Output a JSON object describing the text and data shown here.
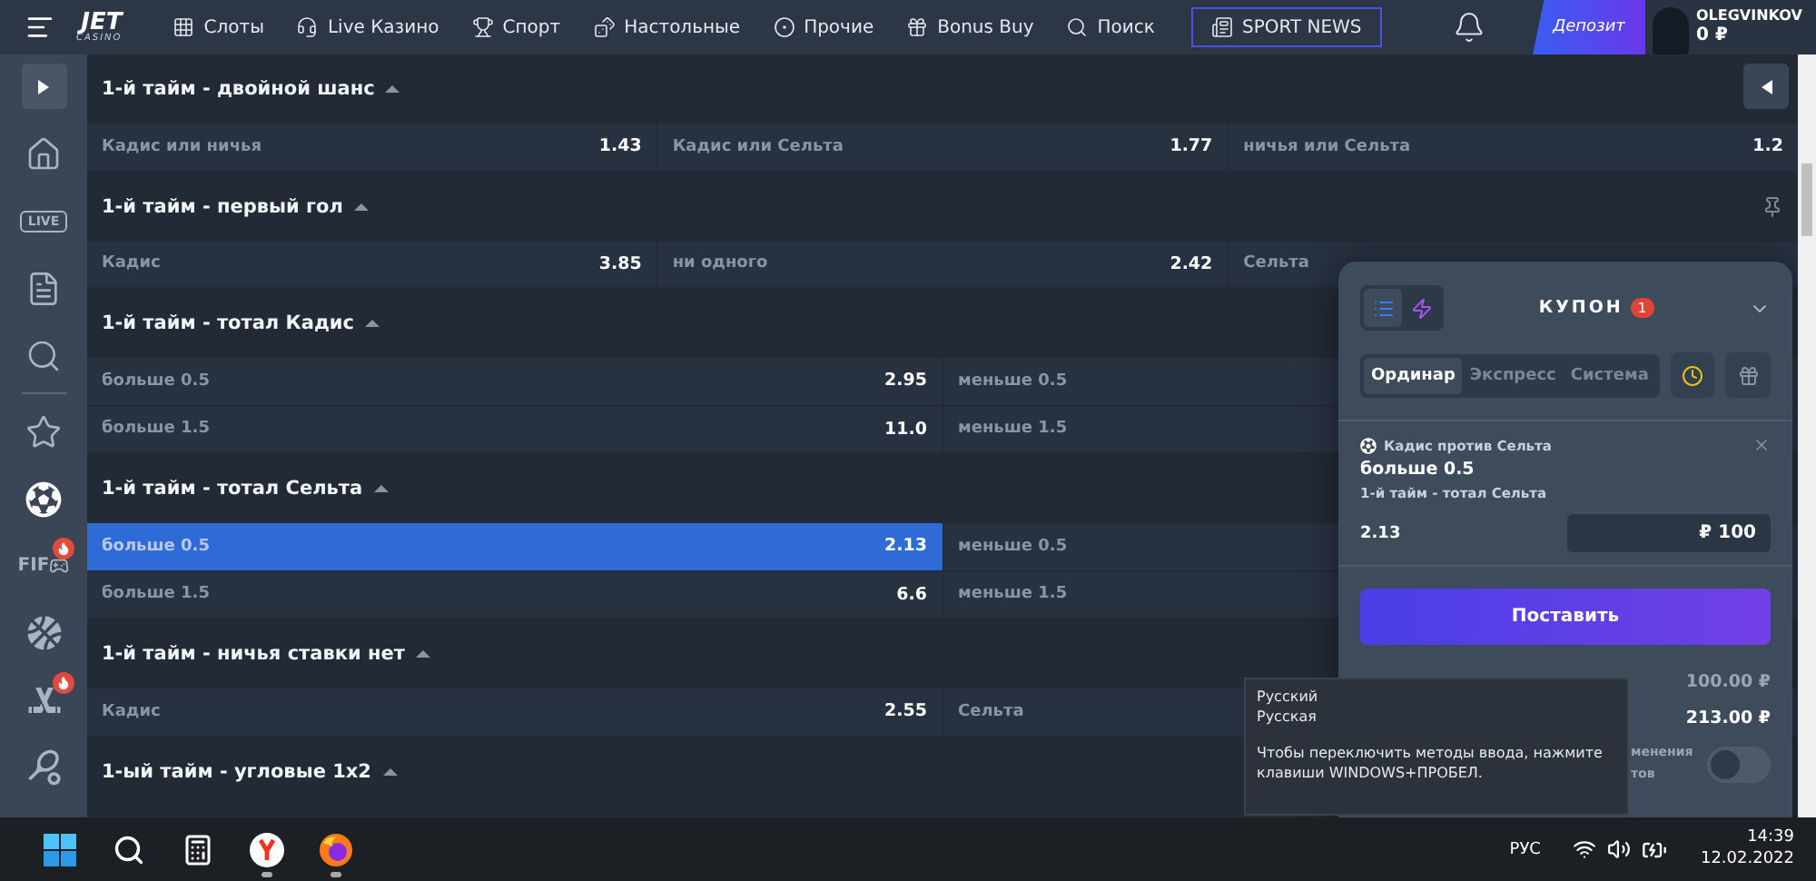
{
  "header": {
    "logo": {
      "name": "JET",
      "sub": "CASINO"
    },
    "nav": [
      {
        "kind": "slots",
        "label": "Слоты",
        "selected": false
      },
      {
        "kind": "live",
        "label": "Live Казино",
        "selected": false
      },
      {
        "kind": "sport",
        "label": "Спорт",
        "selected": false
      },
      {
        "kind": "table",
        "label": "Настольные",
        "selected": false
      },
      {
        "kind": "other",
        "label": "Прочие",
        "selected": false
      },
      {
        "kind": "bonus",
        "label": "Bonus Buy",
        "selected": false
      },
      {
        "kind": "search",
        "label": "Поиск",
        "selected": false
      },
      {
        "kind": "news",
        "label": "SPORT NEWS",
        "selected": true
      }
    ],
    "deposit": "Депозит",
    "user": {
      "name": "OLEGVINKOV",
      "balance": "0 ₽"
    }
  },
  "sidebar": {
    "items": [
      {
        "kind": "home",
        "selected": false,
        "hot": false
      },
      {
        "kind": "live",
        "label": "LIVE",
        "selected": false,
        "hot": false
      },
      {
        "kind": "docs",
        "selected": false,
        "hot": false
      },
      {
        "kind": "search",
        "selected": false,
        "hot": false
      },
      {
        "kind": "star",
        "selected": false,
        "hot": false
      },
      {
        "kind": "soccer",
        "selected": true,
        "hot": false
      },
      {
        "kind": "fifa",
        "label": "FIF",
        "selected": false,
        "hot": true
      },
      {
        "kind": "basketball",
        "selected": false,
        "hot": false
      },
      {
        "kind": "hockey",
        "selected": false,
        "hot": true
      },
      {
        "kind": "tennis",
        "selected": false,
        "hot": false
      }
    ]
  },
  "markets": [
    {
      "title": "1-й тайм - двойной шанс",
      "rows": [
        {
          "cells": [
            {
              "label": "Кадис или ничья",
              "odds": "1.43",
              "selected": false
            },
            {
              "label": "Кадис или Сельта",
              "odds": "1.77",
              "selected": false
            },
            {
              "label": "ничья или Сельта",
              "odds": "1.2",
              "selected": false
            }
          ]
        }
      ]
    },
    {
      "title": "1-й тайм - первый гол",
      "rows": [
        {
          "cells": [
            {
              "label": "Кадис",
              "odds": "3.85",
              "selected": false
            },
            {
              "label": "ни одного",
              "odds": "2.42",
              "selected": false
            },
            {
              "label": "Сельта",
              "selected": false
            }
          ]
        }
      ]
    },
    {
      "title": "1-й тайм - тотал Кадис",
      "rows": [
        {
          "cells": [
            {
              "label": "больше 0.5",
              "odds": "2.95",
              "selected": false
            },
            {
              "label": "меньше 0.5",
              "selected": false
            }
          ]
        },
        {
          "cells": [
            {
              "label": "больше 1.5",
              "odds": "11.0",
              "selected": false
            },
            {
              "label": "меньше 1.5",
              "selected": false
            }
          ]
        }
      ]
    },
    {
      "title": "1-й тайм - тотал Сельта",
      "rows": [
        {
          "cells": [
            {
              "label": "больше 0.5",
              "odds": "2.13",
              "selected": true
            },
            {
              "label": "меньше 0.5",
              "selected": false
            }
          ]
        },
        {
          "cells": [
            {
              "label": "больше 1.5",
              "odds": "6.6",
              "selected": false
            },
            {
              "label": "меньше 1.5",
              "selected": false
            }
          ]
        }
      ]
    },
    {
      "title": "1-й тайм - ничья ставки нет",
      "rows": [
        {
          "cells": [
            {
              "label": "Кадис",
              "odds": "2.55",
              "selected": false
            },
            {
              "label": "Сельта",
              "selected": false
            }
          ]
        }
      ]
    },
    {
      "title": "1-ый тайм - угловые 1x2"
    }
  ],
  "coupon": {
    "title": "КУПОН",
    "count": "1",
    "modes": [
      {
        "kind": "list",
        "selected": true
      },
      {
        "kind": "quick",
        "selected": false
      }
    ],
    "tabs": [
      {
        "label": "Ординар",
        "selected": true
      },
      {
        "label": "Экспресс",
        "selected": false
      },
      {
        "label": "Система",
        "selected": false
      }
    ],
    "bet": {
      "event": "Кадис против Сельта",
      "pick": "больше 0.5",
      "market": "1-й тайм - тотал Сельта",
      "odds": "2.13",
      "stake": "₽ 100"
    },
    "submit": "Поставить",
    "summary": [
      {
        "value": "100.00 ₽",
        "strong": false
      },
      {
        "value": "213.00 ₽",
        "strong": true
      }
    ],
    "option": {
      "label": "менения тов",
      "on": false
    }
  },
  "ime_tooltip": {
    "lines": [
      "Русский",
      "Русская"
    ],
    "message": "Чтобы переключить методы ввода, нажмите клавиши WINDOWS+ПРОБЕЛ."
  },
  "taskbar": {
    "apps": [
      {
        "kind": "windows",
        "running": false
      },
      {
        "kind": "search",
        "running": false
      },
      {
        "kind": "calculator",
        "running": false
      },
      {
        "kind": "yandex",
        "running": true
      },
      {
        "kind": "firefox",
        "running": true
      }
    ],
    "language": "РУС",
    "time": "14:39",
    "date": "12.02.2022"
  }
}
